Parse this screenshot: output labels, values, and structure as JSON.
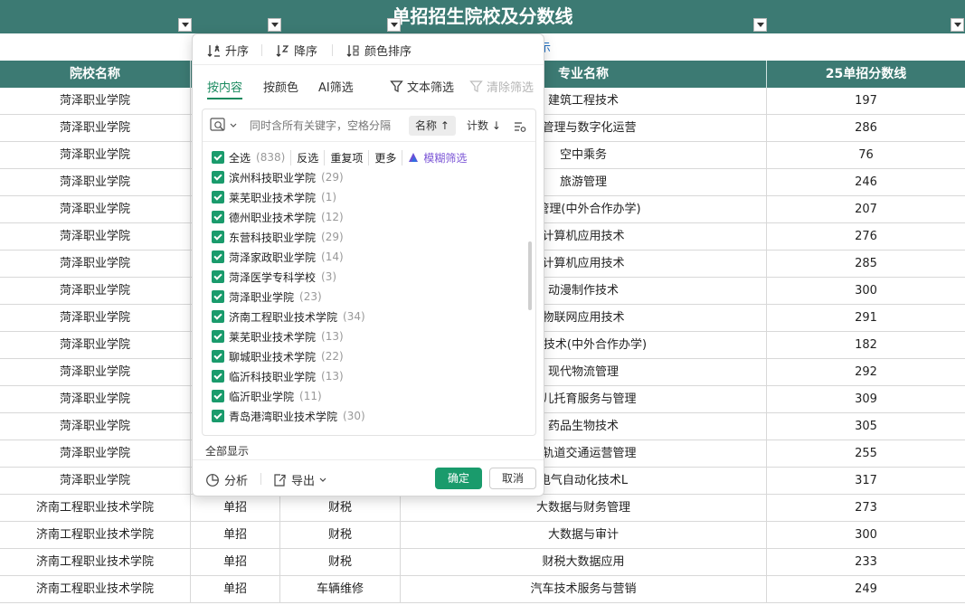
{
  "title": "单招招生院校及分数线",
  "hint": "示",
  "headers": {
    "school": "院校名称",
    "major": "专业名称",
    "score": "25单招分数线"
  },
  "rows": [
    {
      "school": "菏泽职业学院",
      "type": "",
      "category": "",
      "major": "建筑工程技术",
      "score": "197"
    },
    {
      "school": "菏泽职业学院",
      "type": "",
      "category": "",
      "major": "占管理与数字化运营",
      "score": "286"
    },
    {
      "school": "菏泽职业学院",
      "type": "",
      "category": "",
      "major": "空中乘务",
      "score": "76"
    },
    {
      "school": "菏泽职业学院",
      "type": "",
      "category": "",
      "major": "旅游管理",
      "score": "246"
    },
    {
      "school": "菏泽职业学院",
      "type": "",
      "category": "",
      "major": "雪管理(中外合作办学)",
      "score": "207"
    },
    {
      "school": "菏泽职业学院",
      "type": "",
      "category": "",
      "major": "计算机应用技术",
      "score": "276"
    },
    {
      "school": "菏泽职业学院",
      "type": "",
      "category": "",
      "major": "计算机应用技术",
      "score": "285"
    },
    {
      "school": "菏泽职业学院",
      "type": "",
      "category": "",
      "major": "动漫制作技术",
      "score": "300"
    },
    {
      "school": "菏泽职业学院",
      "type": "",
      "category": "",
      "major": "物联网应用技术",
      "score": "291"
    },
    {
      "school": "菏泽职业学院",
      "type": "",
      "category": "",
      "major": "应用技术(中外合作办学)",
      "score": "182"
    },
    {
      "school": "菏泽职业学院",
      "type": "",
      "category": "",
      "major": "现代物流管理",
      "score": "292"
    },
    {
      "school": "菏泽职业学院",
      "type": "",
      "category": "",
      "major": "幼儿托育服务与管理",
      "score": "309"
    },
    {
      "school": "菏泽职业学院",
      "type": "",
      "category": "",
      "major": "药品生物技术",
      "score": "305"
    },
    {
      "school": "菏泽职业学院",
      "type": "",
      "category": "",
      "major": "市轨道交通运营管理",
      "score": "255"
    },
    {
      "school": "菏泽职业学院",
      "type": "",
      "category": "",
      "major": "电气自动化技术L",
      "score": "317"
    },
    {
      "school": "济南工程职业技术学院",
      "type": "单招",
      "category": "财税",
      "major": "大数据与财务管理",
      "score": "273"
    },
    {
      "school": "济南工程职业技术学院",
      "type": "单招",
      "category": "财税",
      "major": "大数据与审计",
      "score": "300"
    },
    {
      "school": "济南工程职业技术学院",
      "type": "单招",
      "category": "财税",
      "major": "财税大数据应用",
      "score": "233"
    },
    {
      "school": "济南工程职业技术学院",
      "type": "单招",
      "category": "车辆维修",
      "major": "汽车技术服务与营销",
      "score": "249"
    }
  ],
  "popup": {
    "sort_asc": "升序",
    "sort_desc": "降序",
    "sort_color": "颜色排序",
    "tab_content": "按内容",
    "tab_color": "按颜色",
    "tab_ai": "AI筛选",
    "text_filter": "文本筛选",
    "clear_filter": "清除筛选",
    "search_placeholder": "同时含所有关键字，空格分隔",
    "sort_name": "名称",
    "sort_count": "计数",
    "select_all": "全选",
    "select_all_count": "(838)",
    "invert": "反选",
    "duplicates": "重复项",
    "more": "更多",
    "fuzzy": "模糊筛选",
    "items": [
      {
        "label": "滨州科技职业学院",
        "count": "(29)"
      },
      {
        "label": "莱芜职业技术学院",
        "count": "(1)"
      },
      {
        "label": "德州职业技术学院",
        "count": "(12)"
      },
      {
        "label": "东营科技职业学院",
        "count": "(29)"
      },
      {
        "label": "菏泽家政职业学院",
        "count": "(14)"
      },
      {
        "label": "菏泽医学专科学校",
        "count": "(3)"
      },
      {
        "label": "菏泽职业学院",
        "count": "(23)"
      },
      {
        "label": "济南工程职业技术学院",
        "count": "(34)"
      },
      {
        "label": "莱芜职业技术学院",
        "count": "(13)"
      },
      {
        "label": "聊城职业技术学院",
        "count": "(22)"
      },
      {
        "label": "临沂科技职业学院",
        "count": "(13)"
      },
      {
        "label": "临沂职业学院",
        "count": "(11)"
      },
      {
        "label": "青岛港湾职业技术学院",
        "count": "(30)"
      }
    ],
    "show_all": "全部显示",
    "analyze": "分析",
    "export": "导出",
    "ok": "确定",
    "cancel": "取消"
  },
  "colors": {
    "header_bg": "#3c7a73",
    "accent": "#1a9b6c",
    "fuzzy": "#7b55d6"
  }
}
